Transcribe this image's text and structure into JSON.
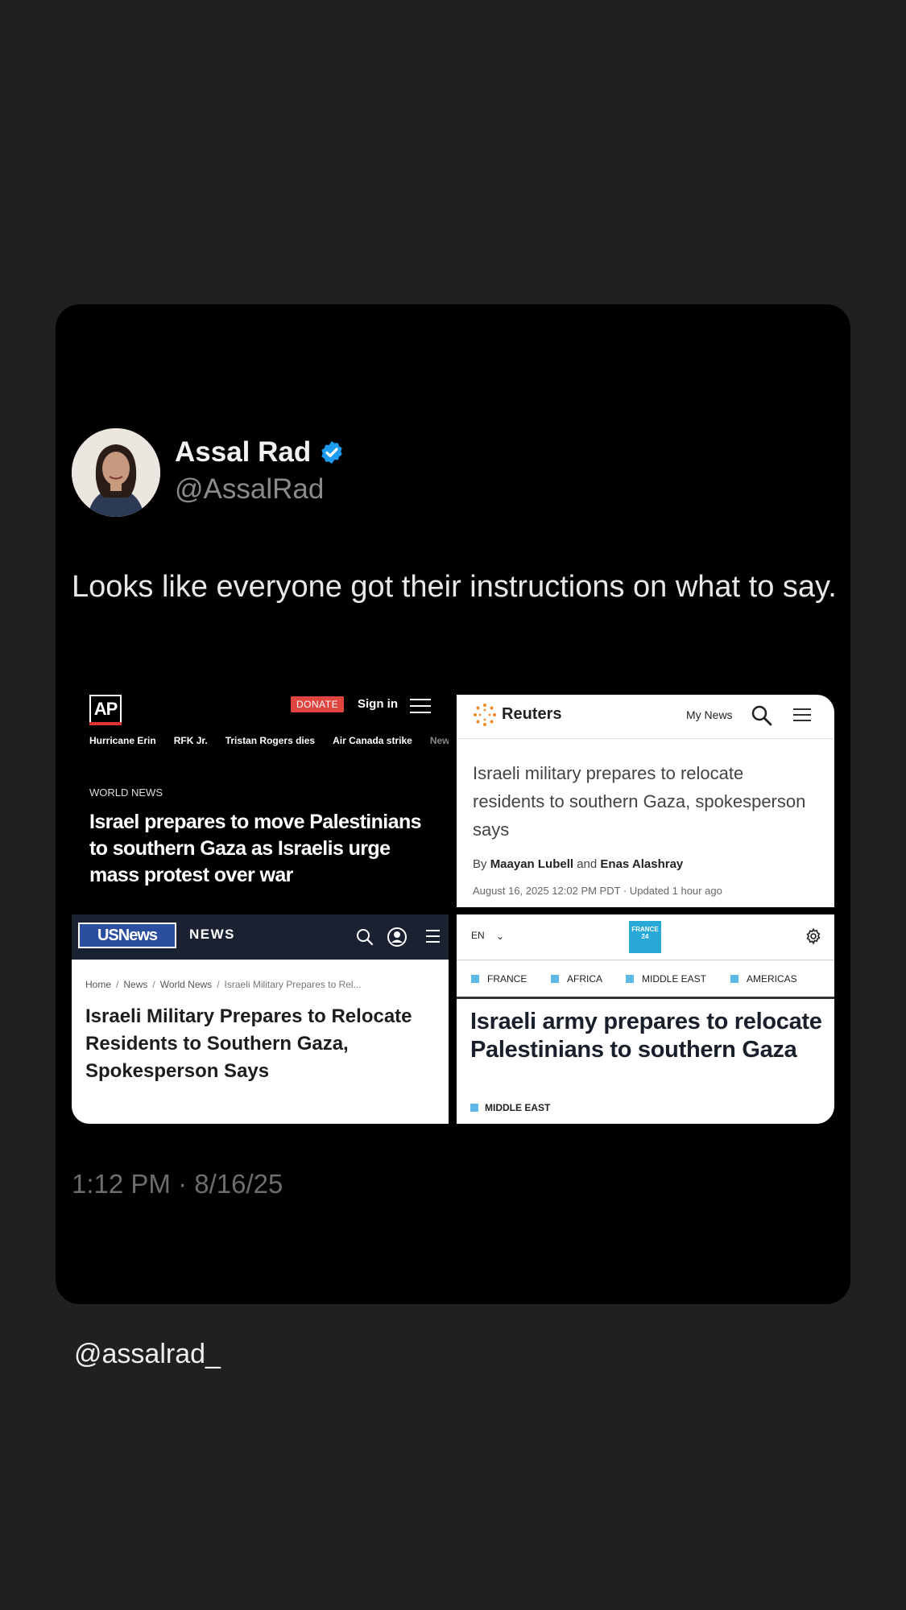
{
  "author": {
    "name": "Assal Rad",
    "handle": "@AssalRad"
  },
  "tweet": {
    "text": "Looks like everyone got their instructions on what to say.",
    "timestamp": "1:12 PM · 8/16/25"
  },
  "ap": {
    "logo": "AP",
    "donate": "DONATE",
    "signin": "Sign in",
    "topics": [
      "Hurricane Erin",
      "RFK Jr.",
      "Tristan Rogers dies",
      "Air Canada strike",
      "New"
    ],
    "kicker": "WORLD NEWS",
    "headline": "Israel prepares to move Palestinians to southern Gaza as Israelis urge mass protest over war"
  },
  "reuters": {
    "brand": "Reuters",
    "my_news": "My News",
    "headline": "Israeli military prepares to relocate residents to southern Gaza, spokesperson says",
    "by": "By",
    "author1": "Maayan Lubell",
    "and": "and",
    "author2": "Enas Alashray",
    "date": "August 16, 2025 12:02 PM PDT · Updated 1 hour ago"
  },
  "usnews": {
    "logo": "USNews",
    "section": "NEWS",
    "breadcrumbs": [
      "Home",
      "News",
      "World News",
      "Israeli Military Prepares to Rel..."
    ],
    "headline": "Israeli Military Prepares to Relocate Residents to Southern Gaza, Spokesperson Says"
  },
  "france24": {
    "lang": "EN",
    "logo": "FRANCE 24",
    "nav": [
      "FRANCE",
      "AFRICA",
      "MIDDLE EAST",
      "AMERICAS"
    ],
    "headline": "Israeli army prepares to relocate Palestinians to southern Gaza",
    "tag": "MIDDLE EAST",
    "accent_color": "#5fb8e5"
  },
  "watermark": "@assalrad_",
  "colors": {
    "verified": "#1d9bf0",
    "ap_donate": "#e0463f",
    "usnews_bar": "#1a2130"
  }
}
